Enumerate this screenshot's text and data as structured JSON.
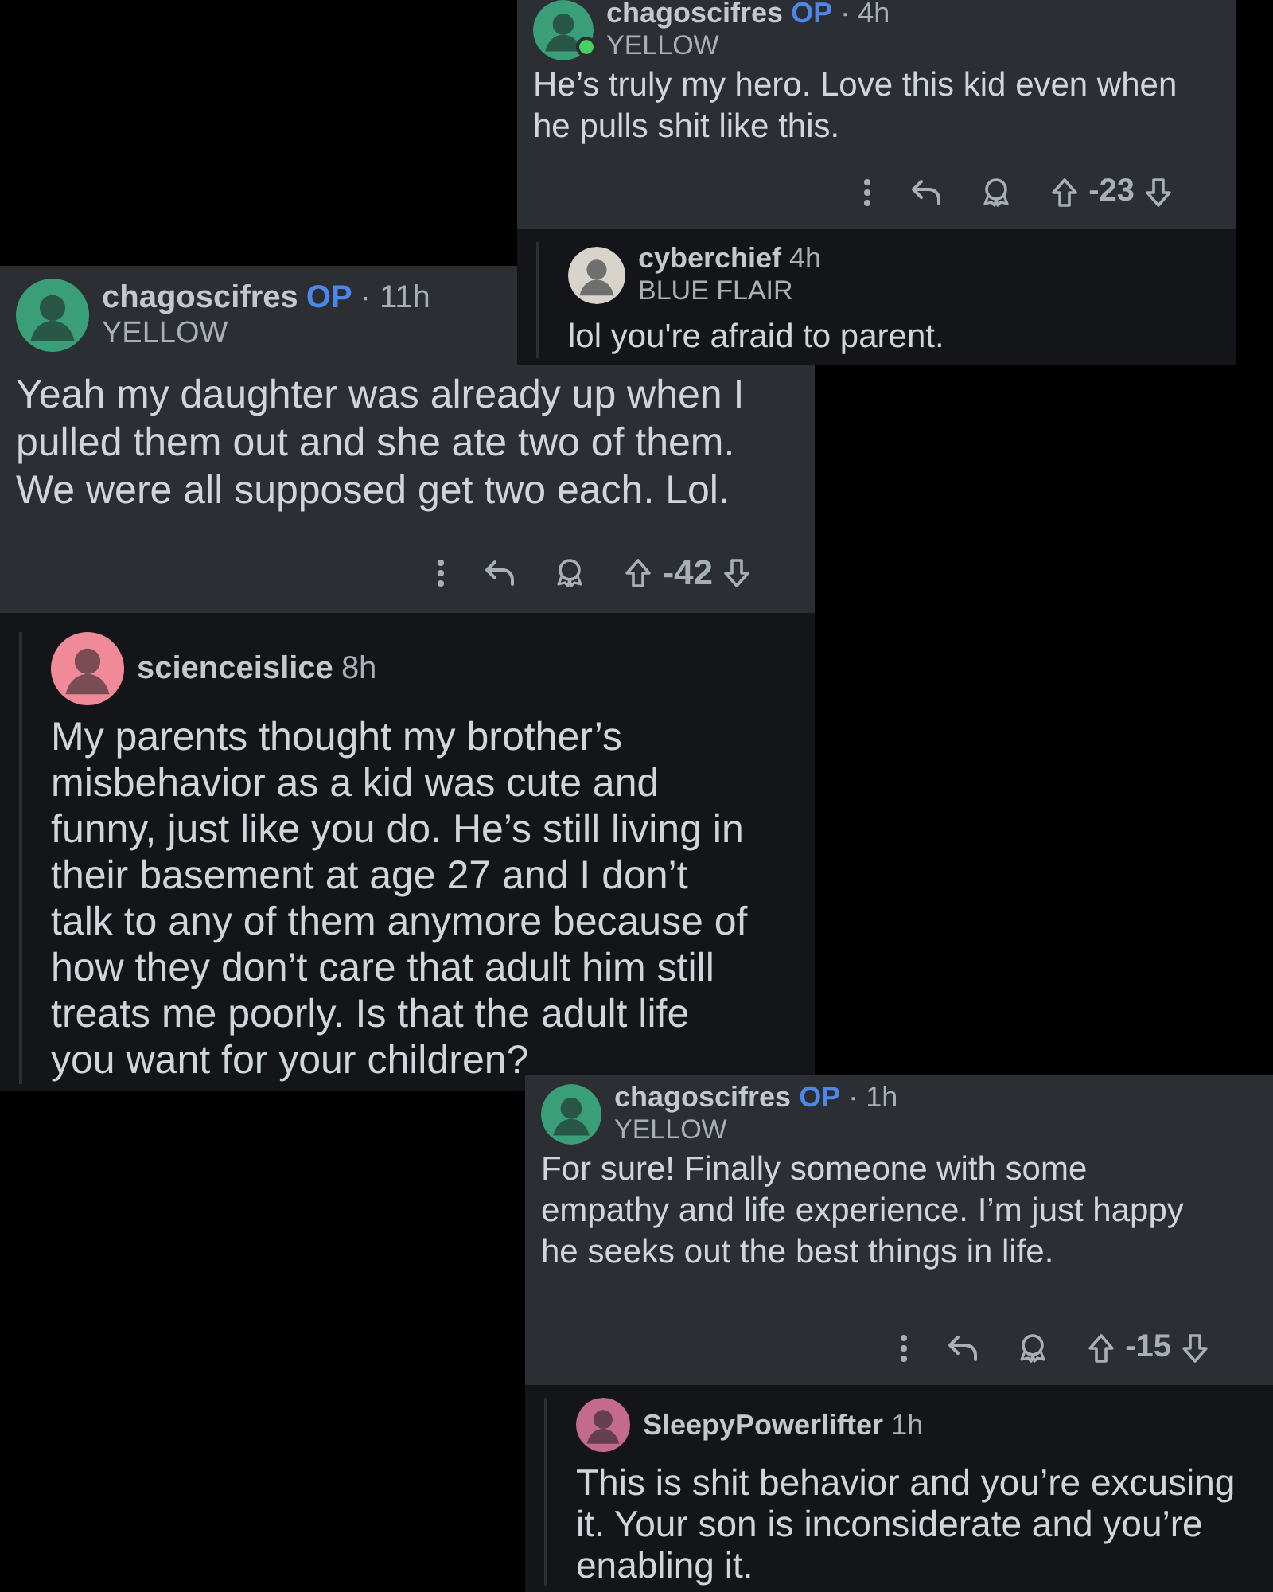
{
  "panels": [
    {
      "comment": {
        "author": "chagoscifres",
        "op_badge": "OP",
        "time": "· 4h",
        "flair": "YELLOW",
        "online": true,
        "body": "He’s truly my hero. Love this kid even when he pulls shit like this.",
        "score": "-23"
      },
      "reply": {
        "author": "cyberchief",
        "time": "4h",
        "flair": "BLUE FLAIR",
        "body": "lol you're afraid to parent."
      }
    },
    {
      "comment": {
        "author": "chagoscifres",
        "op_badge": "OP",
        "time": "· 11h",
        "flair": "YELLOW",
        "online": false,
        "body": "Yeah my daughter was already up when I pulled them out and she ate two of them. We were all supposed get two each. Lol.",
        "score": "-42"
      },
      "reply": {
        "author": "scienceislice",
        "time": "8h",
        "body": "My parents thought my brother’s misbehavior as a kid was cute and funny, just like you do. He’s still living in their basement at age 27 and I don’t talk to any of them anymore because of how they don’t care that adult him still treats me poorly. Is that the adult life you want for your children?"
      }
    },
    {
      "comment": {
        "author": "chagoscifres",
        "op_badge": "OP",
        "time": "· 1h",
        "flair": "YELLOW",
        "online": false,
        "body": "For sure! Finally someone with some empathy and life experience. I’m just happy he seeks out the best things in life.",
        "score": "-15"
      },
      "reply": {
        "author": "SleepyPowerlifter",
        "time": "1h",
        "body": "This is shit behavior and you’re excusing it. Your son is inconsiderate and you’re enabling it."
      }
    }
  ]
}
